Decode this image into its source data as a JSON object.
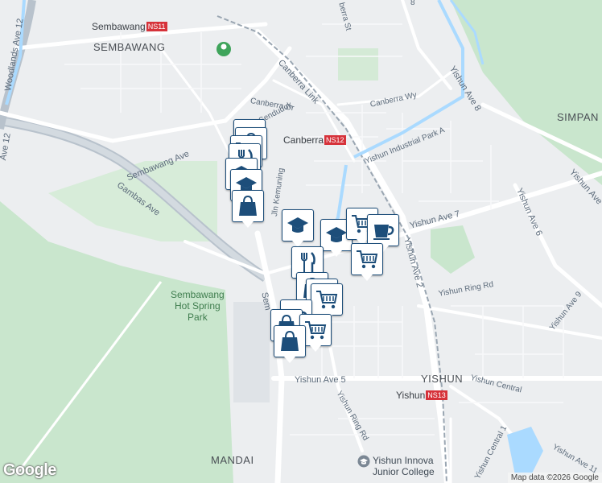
{
  "colors": {
    "background": "#eceef0",
    "park": "#c9e6cd",
    "road": "#ffffff",
    "major_road": "#cfd6dd",
    "water": "#aadaff",
    "pin_border": "#1d4e7a",
    "pin_icon": "#1d4e7a",
    "station_badge": "#d6323a"
  },
  "areas": {
    "sembawang": "SEMBAWANG",
    "simpang": "SIMPAN",
    "yishun": "YISHUN",
    "mandai": "MANDAI",
    "hot_spring_park": "Sembawang\nHot Spring\nPark"
  },
  "stations": [
    {
      "name": "Sembawang",
      "code": "NS11"
    },
    {
      "name": "Canberra",
      "code": "NS12"
    },
    {
      "name": "Yishun",
      "code": "NS13"
    }
  ],
  "roads": {
    "woodlands_ave_12": "Woodlands Ave 12",
    "woodlands_ave_partial": "Ave 12",
    "sembawang_ave": "Sembawang Ave",
    "gambas_ave": "Gambas Ave",
    "canberra_link": "Canberra Link",
    "canberra_dr": "Canberra Dr",
    "canberra_wy": "Canberra Wy",
    "canberra_st": "berra St",
    "sendudok": "Sendudok",
    "kemuning": "Jln Kemuning",
    "yishun_industrial": "Yishun Industrial Park A",
    "yishun_ave_7": "Yishun Ave 7",
    "yishun_ave_8": "Yishun Ave 8",
    "yishun_ave_6": "Yishun Ave 6",
    "yishun_ave_2": "Yishun Ave 2",
    "yishun_ave_5": "Yishun Ave 5",
    "yishun_ave_9": "Yishun Ave 9",
    "yishun_ave_11": "Yishun Ave 11",
    "yishun_ring_rd": "Yishun Ring Rd",
    "yishun_ring_rd_2": "Yishun Ring Rd",
    "yishun_central": "Yishun Central",
    "yishun_central_1": "Yishun Central 1",
    "yishun_ave_top": "Yishun",
    "sembawang_rd": "Sem",
    "ave_8_top": "8",
    "yishun_ave_partial": "Yishun Ave"
  },
  "poi": {
    "junior_college": "Yishun Innova\nJunior College"
  },
  "markers": [
    {
      "icon": "school-icon"
    },
    {
      "icon": "shopping-bag-icon"
    },
    {
      "icon": "cart-icon"
    },
    {
      "icon": "restaurant-icon"
    },
    {
      "icon": "school-icon"
    },
    {
      "icon": "school-icon"
    },
    {
      "icon": "shopping-bag-icon"
    },
    {
      "icon": "school-icon"
    },
    {
      "icon": "school-icon"
    },
    {
      "icon": "cart-icon"
    },
    {
      "icon": "cafe-icon"
    },
    {
      "icon": "restaurant-icon"
    },
    {
      "icon": "cart-icon"
    },
    {
      "icon": "shopping-bag-icon"
    },
    {
      "icon": "cart-icon"
    },
    {
      "icon": "cart-icon"
    },
    {
      "icon": "cafe-icon"
    },
    {
      "icon": "shopping-bag-icon"
    },
    {
      "icon": "cart-icon"
    },
    {
      "icon": "shopping-bag-icon"
    }
  ],
  "branding": {
    "logo": "Google",
    "attribution": "Map data ©2026 Google"
  }
}
